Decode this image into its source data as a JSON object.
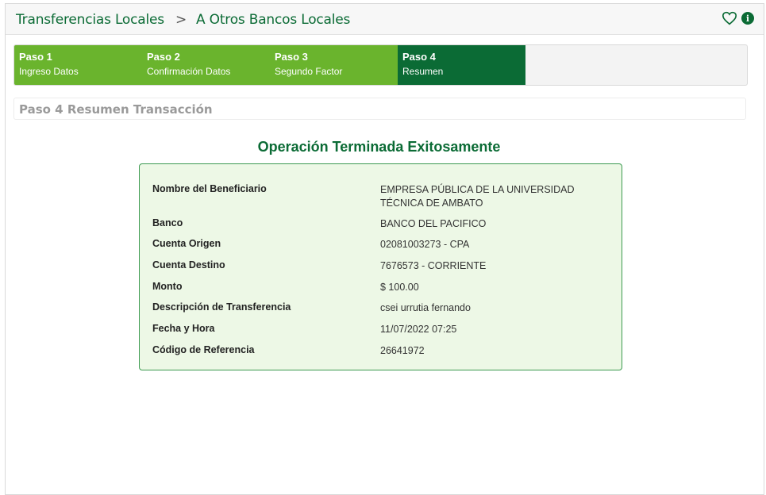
{
  "header": {
    "breadcrumb_parent": "Transferencias Locales",
    "separator": ">",
    "breadcrumb_current": "A Otros Bancos Locales",
    "favorite_icon": "heart-outline-icon",
    "info_icon": "info-circle-icon",
    "info_glyph": "i"
  },
  "steps": [
    {
      "num": "Paso 1",
      "label": "Ingreso Datos",
      "state": "completed"
    },
    {
      "num": "Paso 2",
      "label": "Confirmación Datos",
      "state": "completed"
    },
    {
      "num": "Paso 3",
      "label": "Segundo Factor",
      "state": "completed"
    },
    {
      "num": "Paso 4",
      "label": "Resumen",
      "state": "active"
    }
  ],
  "section_title": "Paso 4 Resumen Transacción",
  "result_message": "Operación Terminada Exitosamente",
  "details": [
    {
      "key": "Nombre del Beneficiario",
      "value": "EMPRESA PÚBLICA DE LA UNIVERSIDAD TÉCNICA DE AMBATO"
    },
    {
      "key": "Banco",
      "value": "BANCO DEL PACIFICO"
    },
    {
      "key": "Cuenta Origen",
      "value": "02081003273 - CPA"
    },
    {
      "key": "Cuenta Destino",
      "value": "7676573 - CORRIENTE"
    },
    {
      "key": "Monto",
      "value": "$ 100.00"
    },
    {
      "key": "Descripción de Transferencia",
      "value": "csei urrutia fernando"
    },
    {
      "key": "Fecha y Hora",
      "value": "11/07/2022 07:25"
    },
    {
      "key": "Código de Referencia",
      "value": "26641972"
    }
  ],
  "colors": {
    "primary_green": "#0b6b35",
    "step_green": "#6ab42d",
    "card_bg": "#edf8e6"
  }
}
